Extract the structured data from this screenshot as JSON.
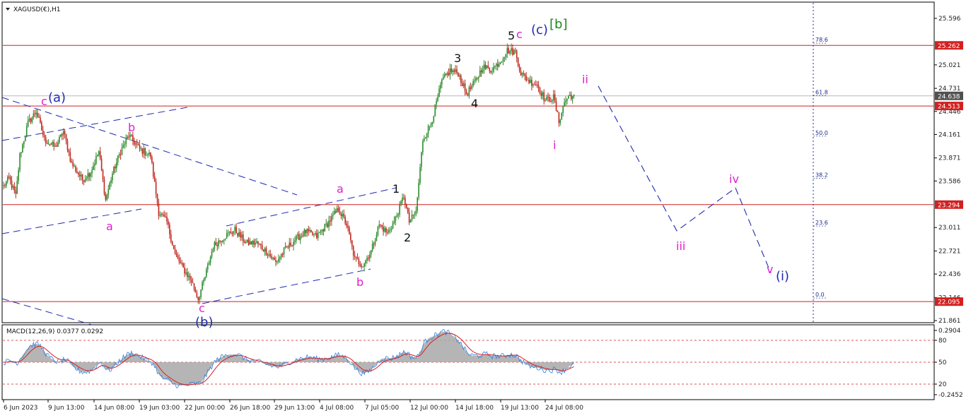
{
  "header": {
    "symbol_title": "XAGUSD(€),H1",
    "macd_title": "MACD(12,26,9) 0.0377 0.0292"
  },
  "colors": {
    "background": "#ffffff",
    "bull": "#2e8b2e",
    "bear": "#c0281e",
    "hline": "#d22020",
    "trend": "#1f2ab0",
    "projection": "#1f2ab0",
    "fib": "#1f2a88",
    "label_magenta": "#e01fd0",
    "label_black": "#111111",
    "label_blue": "#1f2ab0",
    "label_green": "#1a8a1a",
    "price_tag_red": "#d22020",
    "price_tag_gray": "#505050",
    "macd_fill": "#a8a8a8",
    "macd_signal": "#d82020",
    "macd_line": "#2f7fe0",
    "macd_level": "#d22020"
  },
  "chart_data": [
    {
      "type": "candlestick",
      "symbol": "XAGUSD(€)",
      "timeframe": "H1",
      "y_range": [
        21.73,
        25.7
      ],
      "y_ticks": [
        "25.596",
        "25.262",
        "25.021",
        "24.731",
        "24.638",
        "24.513",
        "24.446",
        "24.161",
        "23.871",
        "23.586",
        "23.294",
        "23.011",
        "22.721",
        "22.436",
        "22.146",
        "22.095",
        "21.861"
      ],
      "price_tags": [
        {
          "value": 25.262,
          "label": "25.262",
          "style": "red"
        },
        {
          "value": 24.638,
          "label": "24.638",
          "style": "gray"
        },
        {
          "value": 24.513,
          "label": "24.513",
          "style": "red"
        },
        {
          "value": 23.294,
          "label": "23.294",
          "style": "red"
        },
        {
          "value": 22.095,
          "label": "22.095",
          "style": "red"
        }
      ],
      "horizontal_lines": [
        25.262,
        24.513,
        23.294,
        22.095
      ],
      "current_price_line": 24.638,
      "x_labels": [
        "6 Jun 2023",
        "9 Jun 13:00",
        "14 Jun 08:00",
        "19 Jun 03:00",
        "22 Jun 00:00",
        "26 Jun 18:00",
        "29 Jun 13:00",
        "4 Jul 08:00",
        "7 Jul 05:00",
        "12 Jul 00:00",
        "14 Jul 18:00",
        "19 Jul 13:00",
        "24 Jul 08:00"
      ],
      "path_keypoints": [
        {
          "t": 0,
          "price": 23.52
        },
        {
          "t": 4,
          "price": 23.62
        },
        {
          "t": 9,
          "price": 23.4
        },
        {
          "t": 12,
          "price": 23.9
        },
        {
          "t": 18,
          "price": 24.3
        },
        {
          "t": 24,
          "price": 24.45
        },
        {
          "t": 30,
          "price": 24.1
        },
        {
          "t": 38,
          "price": 24.0
        },
        {
          "t": 44,
          "price": 24.2
        },
        {
          "t": 50,
          "price": 23.8
        },
        {
          "t": 58,
          "price": 23.6
        },
        {
          "t": 64,
          "price": 23.7
        },
        {
          "t": 70,
          "price": 23.95
        },
        {
          "t": 75,
          "price": 23.35
        },
        {
          "t": 80,
          "price": 23.68
        },
        {
          "t": 86,
          "price": 23.95
        },
        {
          "t": 92,
          "price": 24.15
        },
        {
          "t": 100,
          "price": 23.98
        },
        {
          "t": 108,
          "price": 23.9
        },
        {
          "t": 114,
          "price": 23.2
        },
        {
          "t": 120,
          "price": 23.08
        },
        {
          "t": 126,
          "price": 22.68
        },
        {
          "t": 132,
          "price": 22.5
        },
        {
          "t": 138,
          "price": 22.35
        },
        {
          "t": 143,
          "price": 22.13
        },
        {
          "t": 148,
          "price": 22.4
        },
        {
          "t": 154,
          "price": 22.78
        },
        {
          "t": 162,
          "price": 22.9
        },
        {
          "t": 170,
          "price": 22.98
        },
        {
          "t": 178,
          "price": 22.82
        },
        {
          "t": 186,
          "price": 22.82
        },
        {
          "t": 194,
          "price": 22.7
        },
        {
          "t": 200,
          "price": 22.58
        },
        {
          "t": 206,
          "price": 22.72
        },
        {
          "t": 214,
          "price": 22.86
        },
        {
          "t": 222,
          "price": 22.96
        },
        {
          "t": 230,
          "price": 22.9
        },
        {
          "t": 238,
          "price": 23.06
        },
        {
          "t": 246,
          "price": 23.24
        },
        {
          "t": 252,
          "price": 23.05
        },
        {
          "t": 258,
          "price": 22.62
        },
        {
          "t": 264,
          "price": 22.55
        },
        {
          "t": 270,
          "price": 22.72
        },
        {
          "t": 276,
          "price": 23.05
        },
        {
          "t": 282,
          "price": 22.94
        },
        {
          "t": 288,
          "price": 23.12
        },
        {
          "t": 294,
          "price": 23.4
        },
        {
          "t": 298,
          "price": 23.08
        },
        {
          "t": 303,
          "price": 23.2
        },
        {
          "t": 308,
          "price": 24.1
        },
        {
          "t": 314,
          "price": 24.3
        },
        {
          "t": 318,
          "price": 24.55
        },
        {
          "t": 322,
          "price": 24.82
        },
        {
          "t": 328,
          "price": 24.95
        },
        {
          "t": 334,
          "price": 24.92
        },
        {
          "t": 340,
          "price": 24.66
        },
        {
          "t": 346,
          "price": 24.8
        },
        {
          "t": 352,
          "price": 25.0
        },
        {
          "t": 358,
          "price": 24.96
        },
        {
          "t": 364,
          "price": 25.05
        },
        {
          "t": 370,
          "price": 25.2
        },
        {
          "t": 376,
          "price": 25.18
        },
        {
          "t": 380,
          "price": 24.92
        },
        {
          "t": 386,
          "price": 24.82
        },
        {
          "t": 392,
          "price": 24.78
        },
        {
          "t": 398,
          "price": 24.58
        },
        {
          "t": 404,
          "price": 24.62
        },
        {
          "t": 408,
          "price": 24.32
        },
        {
          "t": 412,
          "price": 24.56
        },
        {
          "t": 416,
          "price": 24.65
        },
        {
          "t": 419,
          "price": 24.62
        }
      ],
      "fib_levels": [
        {
          "label": "78.6",
          "price": 25.29
        },
        {
          "label": "61.8",
          "price": 24.64
        },
        {
          "label": "50.0",
          "price": 24.14
        },
        {
          "label": "38.2",
          "price": 23.62
        },
        {
          "label": "23.6",
          "price": 23.03
        },
        {
          "label": "0.0",
          "price": 22.14
        }
      ],
      "projection_path": [
        {
          "label": "ii",
          "price": 24.76
        },
        {
          "label": "iii",
          "price": 22.97
        },
        {
          "label": "iv",
          "price": 23.5
        },
        {
          "label": "v",
          "price": 22.45
        }
      ],
      "wave_labels": [
        {
          "text": "c",
          "color": "magenta"
        },
        {
          "text": "(a)",
          "color": "blue"
        },
        {
          "text": "b",
          "color": "magenta"
        },
        {
          "text": "a",
          "color": "magenta"
        },
        {
          "text": "c",
          "color": "magenta"
        },
        {
          "text": "(b)",
          "color": "blue"
        },
        {
          "text": "a",
          "color": "magenta"
        },
        {
          "text": "b",
          "color": "magenta"
        },
        {
          "text": "1",
          "color": "black"
        },
        {
          "text": "2",
          "color": "black"
        },
        {
          "text": "3",
          "color": "black"
        },
        {
          "text": "4",
          "color": "black"
        },
        {
          "text": "5",
          "color": "black"
        },
        {
          "text": "c",
          "color": "magenta"
        },
        {
          "text": "(c)",
          "color": "blue"
        },
        {
          "text": "[b]",
          "color": "green"
        },
        {
          "text": "i",
          "color": "magenta"
        },
        {
          "text": "ii",
          "color": "magenta"
        },
        {
          "text": "iii",
          "color": "magenta"
        },
        {
          "text": "iv",
          "color": "magenta"
        },
        {
          "text": "v",
          "color": "magenta"
        },
        {
          "text": "(i)",
          "color": "blue"
        }
      ]
    },
    {
      "type": "macd",
      "params": "12,26,9",
      "macd_value": 0.0377,
      "signal_value": 0.0292,
      "y_ticks": [
        "0.2904",
        "80",
        "50",
        "20",
        "-0.2452"
      ],
      "levels": [
        80,
        50,
        20
      ]
    }
  ]
}
